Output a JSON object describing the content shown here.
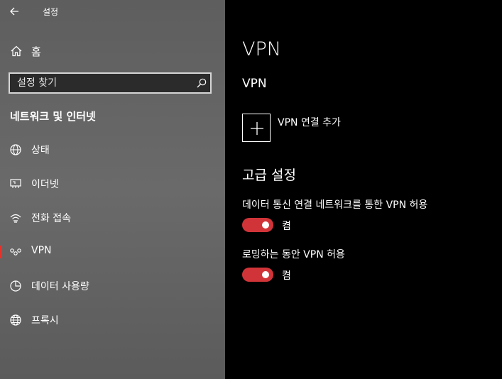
{
  "window": {
    "title": "설정"
  },
  "sidebar": {
    "home_label": "홈",
    "search_placeholder": "설정 찾기",
    "section_title": "네트워크 및 인터넷",
    "items": [
      {
        "label": "상태",
        "icon": "globe-status-icon"
      },
      {
        "label": "이더넷",
        "icon": "ethernet-icon"
      },
      {
        "label": "전화 접속",
        "icon": "dialup-icon"
      },
      {
        "label": "VPN",
        "icon": "vpn-icon",
        "selected": true
      },
      {
        "label": "데이터 사용량",
        "icon": "data-usage-icon"
      },
      {
        "label": "프록시",
        "icon": "globe-icon"
      }
    ]
  },
  "main": {
    "page_title": "VPN",
    "section_vpn": "VPN",
    "add_vpn_label": "VPN 연결 추가",
    "advanced_title": "고급 설정",
    "settings": [
      {
        "label": "데이터 통신 연결 네트워크를 통한 VPN 허용",
        "state": "켬",
        "on": true
      },
      {
        "label": "로밍하는 동안 VPN 허용",
        "state": "켬",
        "on": true
      }
    ]
  },
  "colors": {
    "accent": "#d13438",
    "selection_bar": "#e8312a"
  }
}
